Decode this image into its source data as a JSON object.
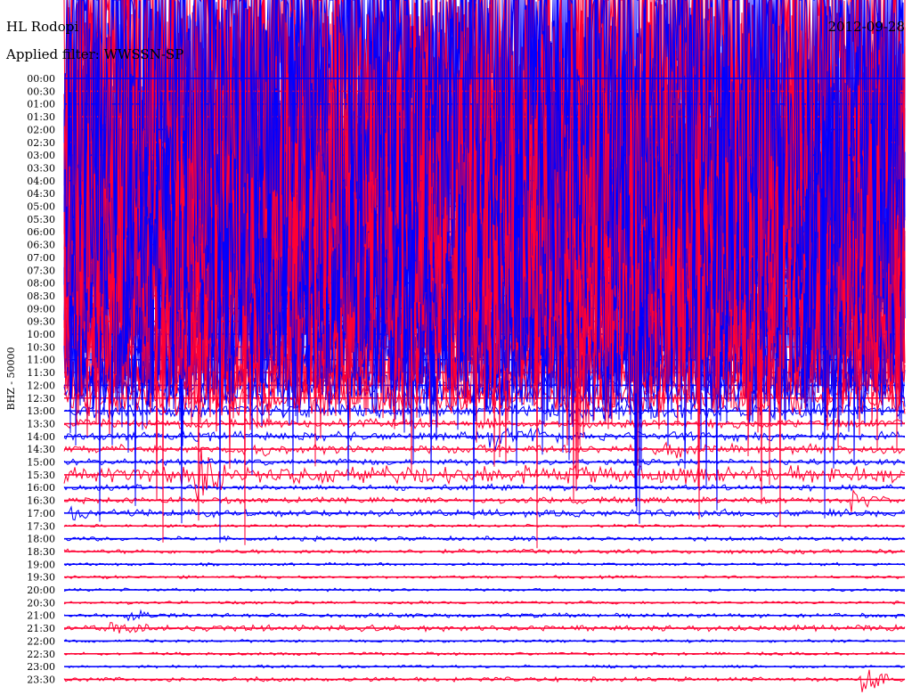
{
  "header": {
    "station": "HL Rodopi",
    "date": "2012-09-28",
    "filter_note": "Applied filter: WWSSN-SP"
  },
  "side_label": "BHZ - 50000",
  "colors": {
    "trace_a": "#0000ff",
    "trace_b": "#ff0033",
    "background": "#ffffff",
    "text": "#000000"
  },
  "chart_data": {
    "type": "line",
    "title": "",
    "xlabel": "",
    "ylabel": "BHZ - 50000",
    "grid": false,
    "row_labels": [
      "00:00",
      "00:30",
      "01:00",
      "01:30",
      "02:00",
      "02:30",
      "03:00",
      "03:30",
      "04:00",
      "04:30",
      "05:00",
      "05:30",
      "06:00",
      "06:30",
      "07:00",
      "07:30",
      "08:00",
      "08:30",
      "09:00",
      "09:30",
      "10:00",
      "10:30",
      "11:00",
      "11:30",
      "12:00",
      "12:30",
      "13:00",
      "13:30",
      "14:00",
      "14:30",
      "15:00",
      "15:30",
      "16:00",
      "16:30",
      "17:00",
      "17:30",
      "18:00",
      "18:30",
      "19:00",
      "19:30",
      "20:00",
      "20:30",
      "21:00",
      "21:30",
      "22:00",
      "22:30",
      "23:00",
      "23:30"
    ],
    "row_amplitude": [
      330,
      310,
      300,
      290,
      280,
      270,
      260,
      250,
      240,
      230,
      220,
      210,
      200,
      190,
      180,
      170,
      160,
      150,
      140,
      130,
      120,
      100,
      70,
      40,
      28,
      22,
      10,
      6,
      6,
      6,
      4,
      12,
      4,
      4,
      5,
      2,
      3,
      3,
      2,
      2,
      2,
      2,
      3,
      4,
      2,
      2,
      2,
      3
    ],
    "events": [
      {
        "row": "14:00",
        "t": 0.51,
        "amp": 10
      },
      {
        "row": "14:00",
        "t": 0.56,
        "amp": 6
      },
      {
        "row": "14:30",
        "t": 0.24,
        "amp": 6
      },
      {
        "row": "14:30",
        "t": 0.72,
        "amp": 8
      },
      {
        "row": "15:30",
        "t": 0.16,
        "amp": 28
      },
      {
        "row": "16:30",
        "t": 0.94,
        "amp": 8
      },
      {
        "row": "17:00",
        "t": 0.01,
        "amp": 5
      },
      {
        "row": "21:00",
        "t": 0.08,
        "amp": 4
      },
      {
        "row": "21:30",
        "t": 0.06,
        "amp": 8
      },
      {
        "row": "23:30",
        "t": 0.95,
        "amp": 16
      }
    ],
    "series": [
      {
        "values_color": "trace_a"
      },
      {
        "values_color": "trace_b"
      }
    ]
  }
}
